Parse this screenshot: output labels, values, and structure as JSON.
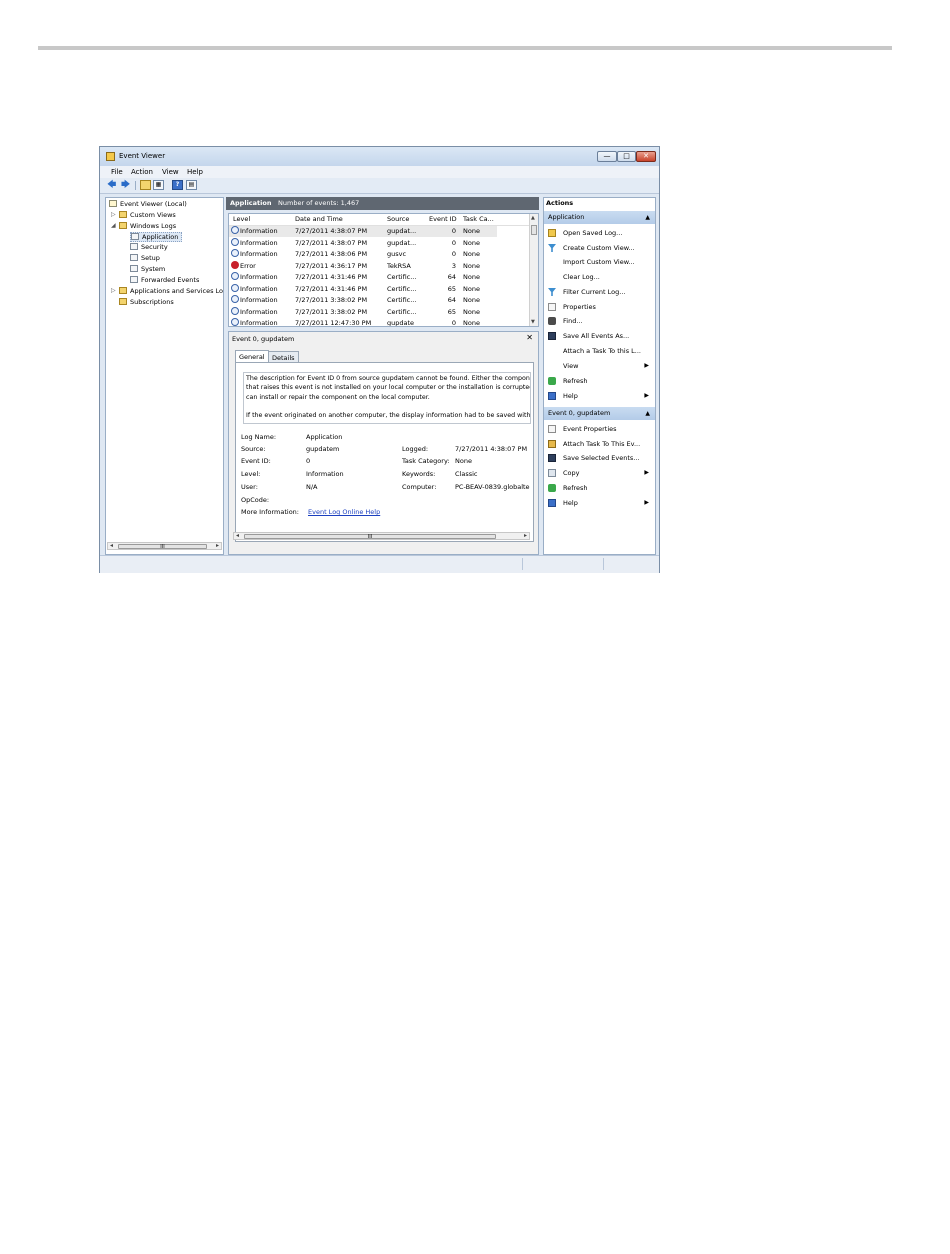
{
  "window": {
    "title": "Event Viewer",
    "controls": {
      "minimize": "—",
      "maximize": "□",
      "close": "✕"
    }
  },
  "menu": [
    "File",
    "Action",
    "View",
    "Help"
  ],
  "toolbar": [
    "back-arrow",
    "forward-arrow",
    "folder",
    "console-tree",
    "help",
    "pane"
  ],
  "tree": {
    "items": [
      {
        "label": "Event Viewer (Local)",
        "icon": "event-viewer-icon"
      },
      {
        "label": "Custom Views",
        "icon": "folder-icon"
      },
      {
        "label": "Windows Logs",
        "icon": "folder-icon"
      },
      {
        "label": "Application",
        "icon": "log-icon"
      },
      {
        "label": "Security",
        "icon": "log-icon"
      },
      {
        "label": "Setup",
        "icon": "log-icon"
      },
      {
        "label": "System",
        "icon": "log-icon"
      },
      {
        "label": "Forwarded Events",
        "icon": "log-icon"
      },
      {
        "label": "Applications and Services Lo",
        "icon": "folder-icon"
      },
      {
        "label": "Subscriptions",
        "icon": "folder-icon"
      }
    ],
    "scroll_mark": "III"
  },
  "list": {
    "title": "Application",
    "count": "Number of events: 1,467",
    "columns": [
      "Level",
      "Date and Time",
      "Source",
      "Event ID",
      "Task Ca..."
    ],
    "rows": [
      {
        "level": "Information",
        "date": "7/27/2011 4:38:07 PM",
        "source": "gupdat...",
        "id": "0",
        "task": "None"
      },
      {
        "level": "Information",
        "date": "7/27/2011 4:38:07 PM",
        "source": "gupdat...",
        "id": "0",
        "task": "None"
      },
      {
        "level": "Information",
        "date": "7/27/2011 4:38:06 PM",
        "source": "gusvc",
        "id": "0",
        "task": "None"
      },
      {
        "level": "Error",
        "date": "7/27/2011 4:36:17 PM",
        "source": "TekRSA",
        "id": "3",
        "task": "None"
      },
      {
        "level": "Information",
        "date": "7/27/2011 4:31:46 PM",
        "source": "Certific...",
        "id": "64",
        "task": "None"
      },
      {
        "level": "Information",
        "date": "7/27/2011 4:31:46 PM",
        "source": "Certific...",
        "id": "65",
        "task": "None"
      },
      {
        "level": "Information",
        "date": "7/27/2011 3:38:02 PM",
        "source": "Certific...",
        "id": "64",
        "task": "None"
      },
      {
        "level": "Information",
        "date": "7/27/2011 3:38:02 PM",
        "source": "Certific...",
        "id": "65",
        "task": "None"
      },
      {
        "level": "Information",
        "date": "7/27/2011 12:47:30 PM",
        "source": "gupdate",
        "id": "0",
        "task": "None"
      }
    ]
  },
  "detail": {
    "title": "Event 0, gupdatem",
    "close": "✕",
    "tabs": [
      "General",
      "Details"
    ],
    "description": [
      "The description for Event ID 0 from source gupdatem cannot be found. Either the compon",
      "that raises this event is not installed on your local computer or the installation is corruptec",
      "can install or repair the component on the local computer.",
      "If the event originated on another computer, the display information had to be saved with"
    ],
    "props": {
      "log_name_label": "Log Name:",
      "log_name": "Application",
      "source_label": "Source:",
      "source": "gupdatem",
      "logged_label": "Logged:",
      "logged": "7/27/2011 4:38:07 PM",
      "event_id_label": "Event ID:",
      "event_id": "0",
      "task_category_label": "Task Category:",
      "task_category": "None",
      "level_label": "Level:",
      "level": "Information",
      "keywords_label": "Keywords:",
      "keywords": "Classic",
      "user_label": "User:",
      "user": "N/A",
      "computer_label": "Computer:",
      "computer": "PC-BEAV-0839.globalte",
      "opcode_label": "OpCode:",
      "more_info_label": "More Information:",
      "more_info_link": "Event Log Online Help"
    },
    "scroll_mark": "III"
  },
  "actions": {
    "header": "Actions",
    "section1": "Application",
    "items1": [
      {
        "label": "Open Saved Log...",
        "icon": "folder-icon"
      },
      {
        "label": "Create Custom View...",
        "icon": "filter-icon"
      },
      {
        "label": "Import Custom View...",
        "icon": ""
      },
      {
        "label": "Clear Log...",
        "icon": ""
      },
      {
        "label": "Filter Current Log...",
        "icon": "filter-icon"
      },
      {
        "label": "Properties",
        "icon": "properties-icon"
      },
      {
        "label": "Find...",
        "icon": "binoculars-icon"
      },
      {
        "label": "Save All Events As...",
        "icon": "save-icon"
      },
      {
        "label": "Attach a Task To this L...",
        "icon": ""
      },
      {
        "label": "View",
        "icon": "",
        "submenu": "▶"
      },
      {
        "label": "Refresh",
        "icon": "refresh-icon"
      },
      {
        "label": "Help",
        "icon": "help-icon",
        "submenu": "▶"
      }
    ],
    "section2": "Event 0, gupdatem",
    "items2": [
      {
        "label": "Event Properties",
        "icon": "properties-icon"
      },
      {
        "label": "Attach Task To This Ev...",
        "icon": "task-icon"
      },
      {
        "label": "Save Selected Events...",
        "icon": "save-icon"
      },
      {
        "label": "Copy",
        "icon": "copy-icon",
        "submenu": "▶"
      },
      {
        "label": "Refresh",
        "icon": "refresh-icon"
      },
      {
        "label": "Help",
        "icon": "help-icon",
        "submenu": "▶"
      }
    ]
  }
}
